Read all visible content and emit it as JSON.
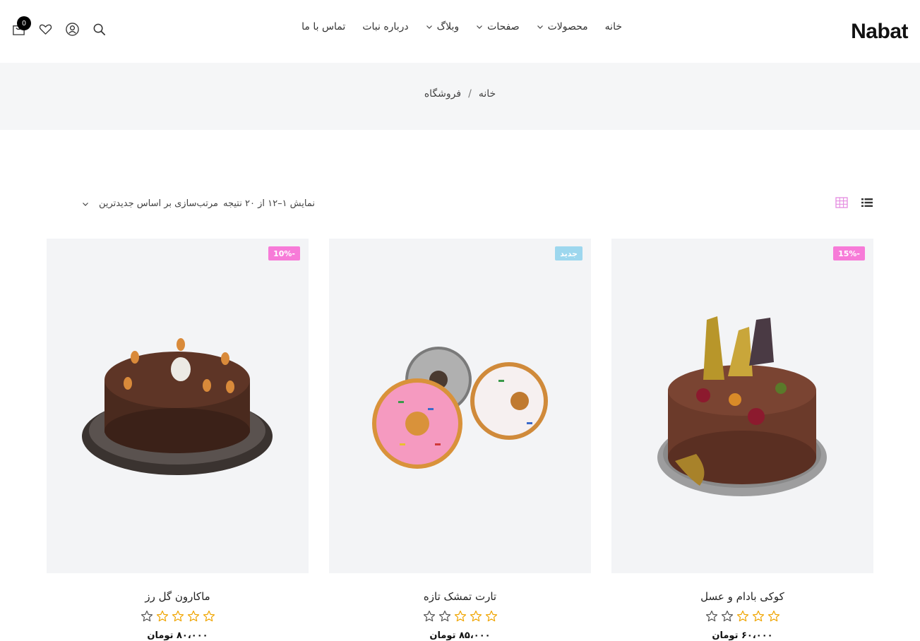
{
  "header": {
    "logo": "Nabat",
    "nav": [
      {
        "label": "خانه",
        "dropdown": false
      },
      {
        "label": "محصولات",
        "dropdown": true
      },
      {
        "label": "صفحات",
        "dropdown": true
      },
      {
        "label": "وبلاگ",
        "dropdown": true
      },
      {
        "label": "درباره نبات",
        "dropdown": false
      },
      {
        "label": "تماس با ما",
        "dropdown": false
      }
    ],
    "cart_count": "0",
    "icons": [
      "cart-icon",
      "heart-icon",
      "user-icon",
      "search-icon"
    ]
  },
  "breadcrumb": {
    "home": "خانه",
    "separator": "/",
    "current": "فروشگاه"
  },
  "toolbar": {
    "result_count": "نمایش ۱–۱۲ از ۲۰ نتیجه",
    "sort_label": "مرتب‌سازی بر اساس جدیدترین",
    "views": [
      "grid-view-icon",
      "list-view-icon"
    ]
  },
  "products": [
    {
      "title": "کوکی بادام و عسل",
      "badge": "15%-",
      "badge_color": "#f77bd8",
      "rating": 3,
      "price": "۶۰،۰۰۰ تومان"
    },
    {
      "title": "تارت تمشک تازه",
      "badge": "جدید",
      "badge_color": "#9dd7ee",
      "rating": 3,
      "price": "۸۵،۰۰۰ تومان"
    },
    {
      "title": "ماکارون گل رز",
      "badge": "10%-",
      "badge_color": "#f77bd8",
      "rating": 4,
      "price": "۸۰،۰۰۰ تومان"
    }
  ],
  "colors": {
    "accent_pink": "#f77bd8",
    "accent_blue": "#9dd7ee",
    "star": "#f0a500",
    "breadcrumb_bg": "#f5f6f7",
    "card_bg": "#f3f4f6"
  }
}
